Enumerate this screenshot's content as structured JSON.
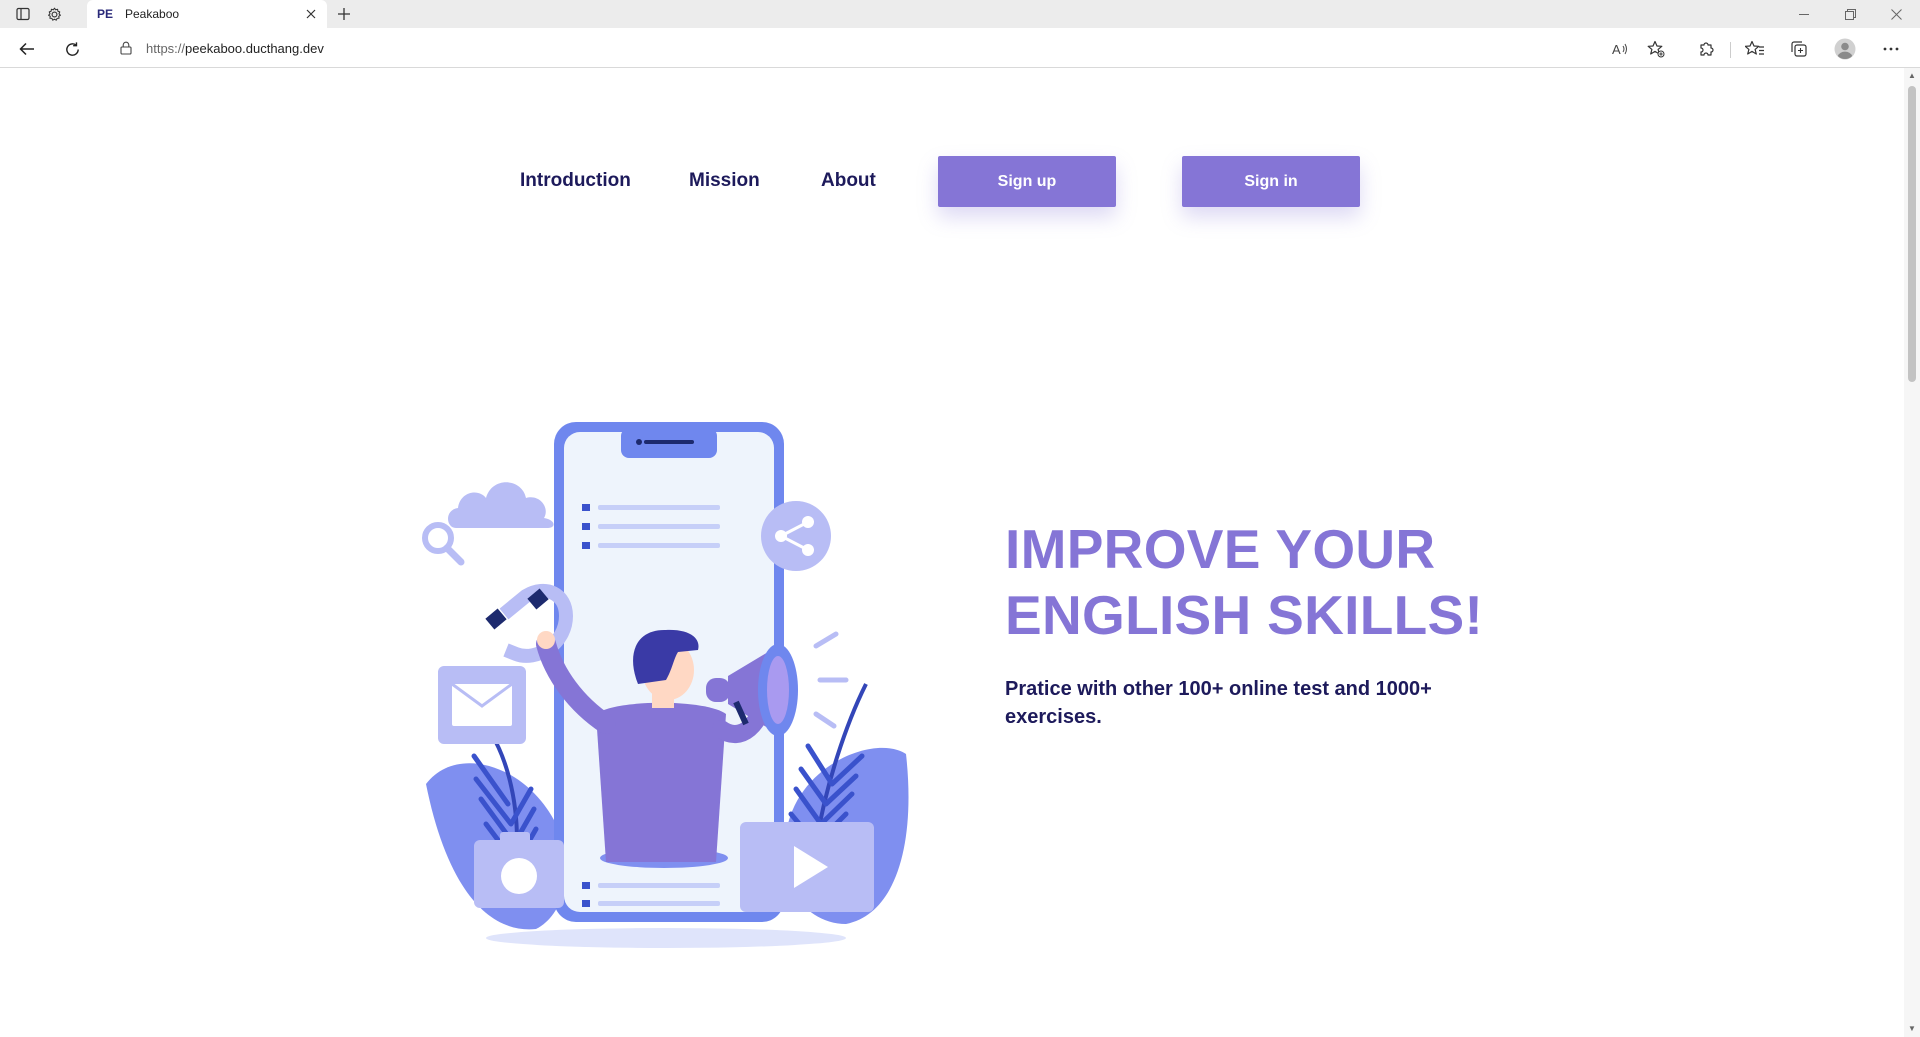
{
  "browser": {
    "tab": {
      "favicon_text": "PE",
      "title": "Peakaboo"
    },
    "address": {
      "scheme": "https://",
      "host": "peekaboo.ducthang.dev"
    }
  },
  "site": {
    "nav": {
      "introduction": "Introduction",
      "mission": "Mission",
      "about": "About",
      "signup": "Sign up",
      "signin": "Sign in"
    },
    "hero": {
      "title_line1": "IMPROVE YOUR",
      "title_line2": "ENGLISH SKILLS!",
      "subtitle": "Pratice with other 100+ online test and 1000+ exercises."
    }
  },
  "colors": {
    "accent": "#8575d6",
    "heading_dark": "#1d1a5b",
    "illustration_light": "#b8bdf5",
    "illustration_blue": "#6f87ee"
  }
}
